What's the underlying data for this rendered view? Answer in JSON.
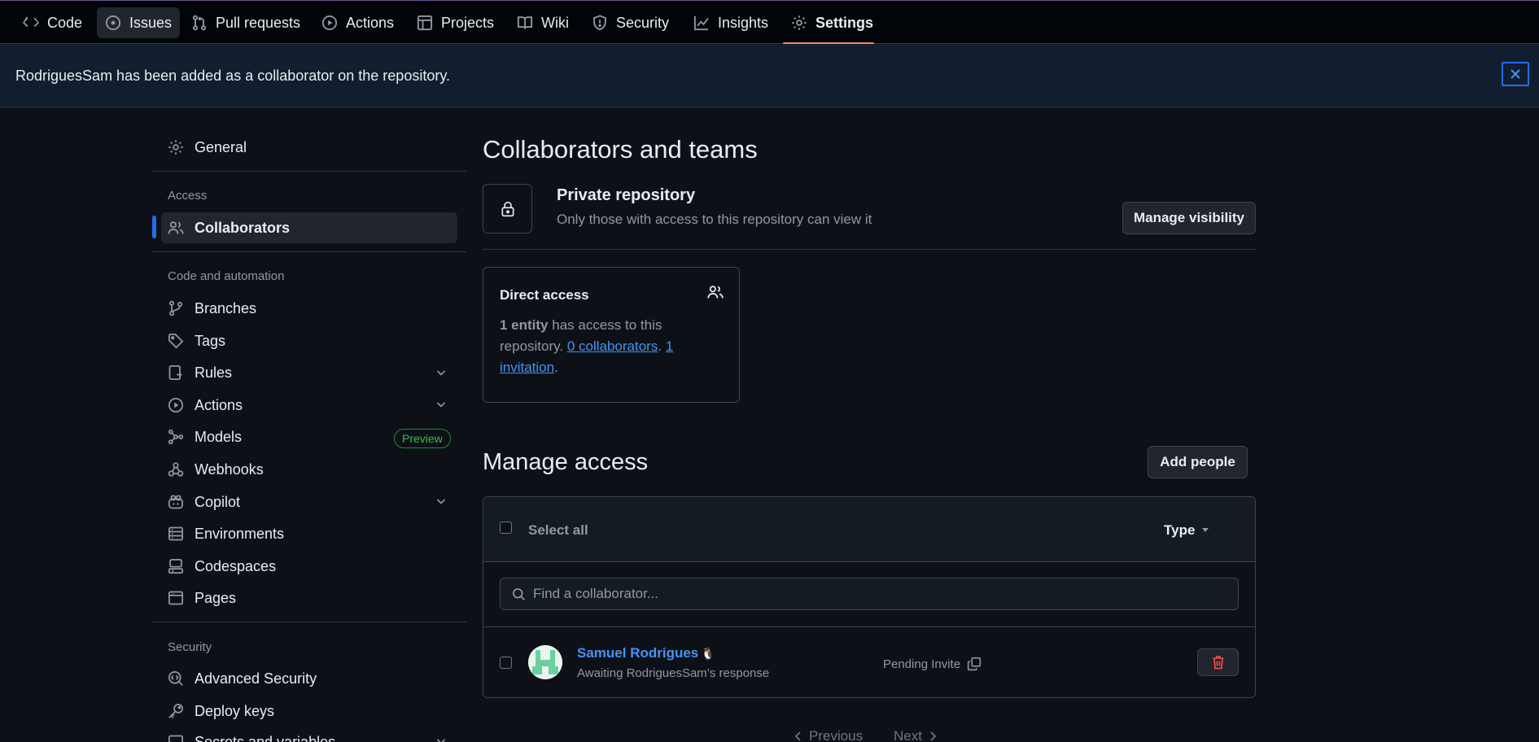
{
  "nav": {
    "tabs": [
      {
        "label": "Code",
        "icon": "code-icon"
      },
      {
        "label": "Issues",
        "icon": "issue-icon"
      },
      {
        "label": "Pull requests",
        "icon": "pull-request-icon"
      },
      {
        "label": "Actions",
        "icon": "play-icon"
      },
      {
        "label": "Projects",
        "icon": "table-icon"
      },
      {
        "label": "Wiki",
        "icon": "book-icon"
      },
      {
        "label": "Security",
        "icon": "shield-icon"
      },
      {
        "label": "Insights",
        "icon": "graph-icon"
      },
      {
        "label": "Settings",
        "icon": "gear-icon"
      }
    ],
    "active_tab": "Settings"
  },
  "flash": {
    "message": "RodriguesSam has been added as a collaborator on the repository."
  },
  "sidebar": {
    "general": "General",
    "sections": {
      "access": "Access",
      "code_automation": "Code and automation",
      "security": "Security"
    },
    "items": {
      "collaborators": "Collaborators",
      "branches": "Branches",
      "tags": "Tags",
      "rules": "Rules",
      "actions": "Actions",
      "models": "Models",
      "models_badge": "Preview",
      "webhooks": "Webhooks",
      "copilot": "Copilot",
      "environments": "Environments",
      "codespaces": "Codespaces",
      "pages": "Pages",
      "advanced_security": "Advanced Security",
      "deploy_keys": "Deploy keys",
      "secrets": "Secrets and variables"
    }
  },
  "main": {
    "title": "Collaborators and teams",
    "visibility": {
      "title": "Private repository",
      "description": "Only those with access to this repository can view it",
      "button": "Manage visibility"
    },
    "direct_access": {
      "title": "Direct access",
      "entity_count": "1 entity",
      "text1": " has access to this repository. ",
      "collaborators_link": "0 collaborators",
      "sep": ". ",
      "invitation_link": "1 invitation",
      "end": "."
    },
    "manage": {
      "title": "Manage access",
      "add_button": "Add people",
      "select_all": "Select all",
      "type_filter": "Type",
      "search_placeholder": "Find a collaborator...",
      "rows": [
        {
          "name": "Samuel Rodrigues",
          "emoji": "🐧",
          "subtitle": "Awaiting RodriguesSam’s response",
          "status": "Pending Invite"
        }
      ]
    },
    "pagination": {
      "previous": "Previous",
      "next": "Next"
    }
  },
  "colors": {
    "accent": "#1f6feb",
    "link": "#4493f8",
    "tab_underline": "#f78166",
    "danger": "#f85149",
    "success": "#3fb950"
  }
}
